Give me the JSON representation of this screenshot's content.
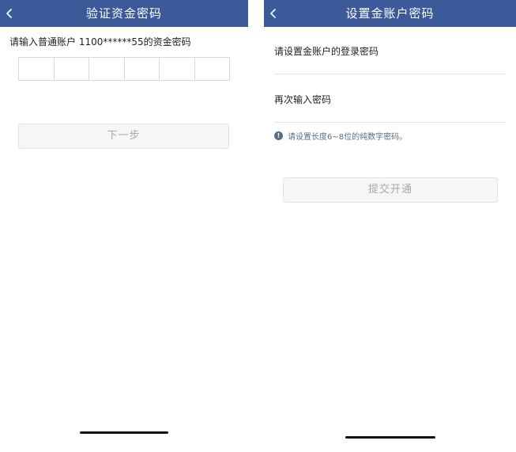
{
  "left_screen": {
    "nav": {
      "title": "验证资金密码",
      "back_icon": "chevron-left-icon"
    },
    "prompt": "请输入普通账户 1100******55的资金密码",
    "pin_length": 6,
    "next_button": "下一步"
  },
  "right_screen": {
    "nav": {
      "title": "设置金账户密码",
      "back_icon": "chevron-left-icon"
    },
    "login_password_label": "请设置金账户的登录密码",
    "confirm_password_label": "再次输入密码",
    "hint_icon": "exclamation-circle-icon",
    "hint": "请设置长度6~8位的纯数字密码。",
    "submit_button": "提交开通"
  },
  "colors": {
    "nav_background": "#3c5a9a",
    "nav_text": "#ffffff",
    "disabled_button_text": "#a8a8a8",
    "hint_text": "#5c6d7e"
  }
}
